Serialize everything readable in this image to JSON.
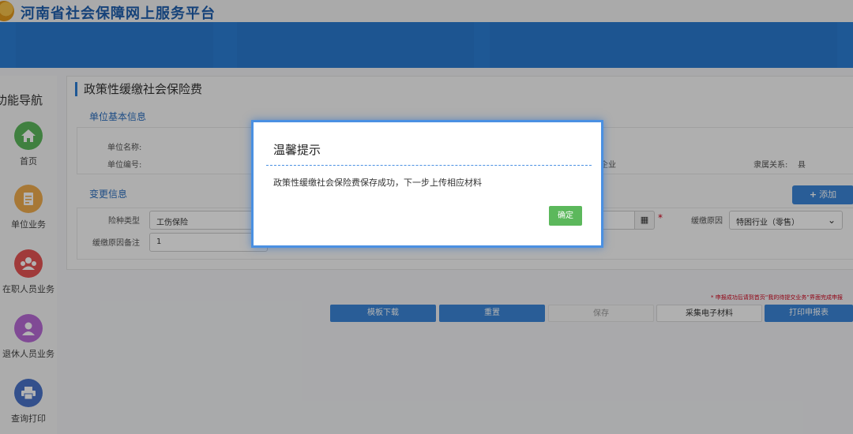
{
  "header": {
    "site_title": "河南省社会保障网上服务平台"
  },
  "sidebar": {
    "title": "功能导航",
    "items": [
      {
        "label": "首页",
        "icon": "home-icon",
        "color": "#5cb85c"
      },
      {
        "label": "单位业务",
        "icon": "document-icon",
        "color": "#f0ad4e"
      },
      {
        "label": "在职人员业务",
        "icon": "group-icon",
        "color": "#e55353"
      },
      {
        "label": "退休人员业务",
        "icon": "person-icon",
        "color": "#b86bd6"
      },
      {
        "label": "查询打印",
        "icon": "printer-icon",
        "color": "#4a73c9"
      }
    ]
  },
  "page": {
    "title": "政策性缓缴社会保险费",
    "unit_section": {
      "title": "单位基本信息",
      "unit_name_label": "单位名称:",
      "unit_code_label": "单位编号:",
      "unit_type_value": "企业",
      "affiliation_label": "隶属关系:",
      "affiliation_value": "县"
    },
    "change_section": {
      "title": "变更信息",
      "insurance_type_label": "险种类型",
      "insurance_type_value": "工伤保险",
      "reason_label": "缓缴原因",
      "reason_value": "特困行业（零售）",
      "remark_label": "缓缴原因备注",
      "remark_value": "1",
      "add_button": "添加"
    },
    "notice": "* 申报成功后请到首页“我的待提交业务”界面完成申报",
    "buttons": {
      "template_download": "模板下载",
      "reset": "重置",
      "save": "保存",
      "collect_materials": "采集电子材料",
      "print_form": "打印申报表"
    }
  },
  "modal": {
    "title": "温馨提示",
    "message": "政策性缓缴社会保险费保存成功，下一步上传相应材料",
    "ok_label": "确定"
  },
  "colors": {
    "brand_blue": "#2c7fd6",
    "ok_green": "#5cb85c",
    "required_red": "#d0021b"
  }
}
